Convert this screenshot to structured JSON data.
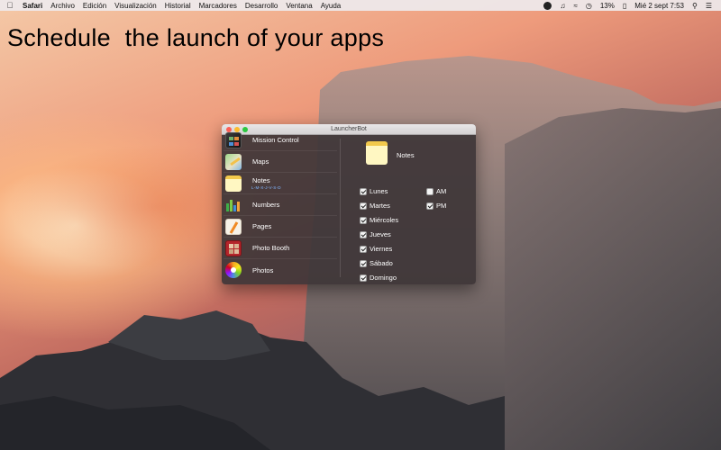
{
  "menubar": {
    "apple_icon": "apple-icon",
    "app_name": "Safari",
    "items": [
      "Archivo",
      "Edición",
      "Visualización",
      "Historial",
      "Marcadores",
      "Desarrollo",
      "Ventana",
      "Ayuda"
    ],
    "status": {
      "battery": "13%",
      "datetime": "Mié 2 sept  7:53"
    }
  },
  "headline": "Schedule  the launch of your apps",
  "window": {
    "title": "LauncherBot",
    "apps": [
      {
        "name": "Mission Control",
        "sub": "",
        "icon": "mission-control-icon"
      },
      {
        "name": "Maps",
        "sub": "",
        "icon": "maps-icon"
      },
      {
        "name": "Notes",
        "sub": "L-M-X-J-V-S-D",
        "icon": "notes-icon"
      },
      {
        "name": "Numbers",
        "sub": "",
        "icon": "numbers-icon"
      },
      {
        "name": "Pages",
        "sub": "",
        "icon": "pages-icon"
      },
      {
        "name": "Photo Booth",
        "sub": "",
        "icon": "photo-booth-icon"
      },
      {
        "name": "Photos",
        "sub": "",
        "icon": "photos-icon"
      }
    ],
    "detail": {
      "app_title": "Notes",
      "days": [
        {
          "label": "Lunes",
          "checked": true
        },
        {
          "label": "Martes",
          "checked": true
        },
        {
          "label": "Miércoles",
          "checked": true
        },
        {
          "label": "Jueves",
          "checked": true
        },
        {
          "label": "Viernes",
          "checked": true
        },
        {
          "label": "Sábado",
          "checked": true
        },
        {
          "label": "Domingo",
          "checked": true
        }
      ],
      "periods": [
        {
          "label": "AM",
          "checked": false
        },
        {
          "label": "PM",
          "checked": true
        }
      ]
    }
  }
}
